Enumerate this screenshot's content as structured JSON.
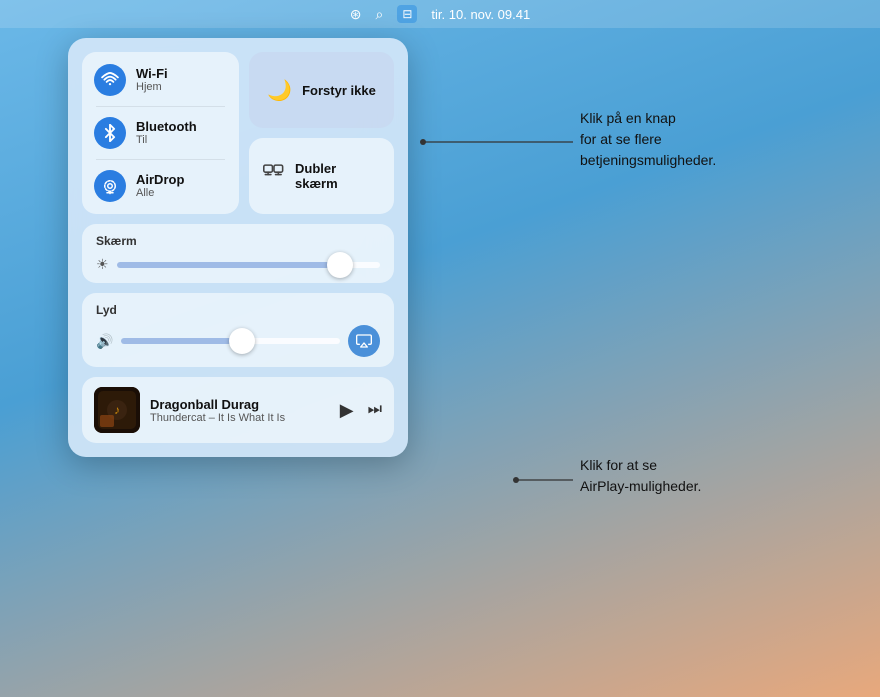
{
  "menubar": {
    "date_time": "tir. 10. nov.  09.41"
  },
  "control_center": {
    "wifi": {
      "title": "Wi-Fi",
      "subtitle": "Hjem"
    },
    "bluetooth": {
      "title": "Bluetooth",
      "subtitle": "Til"
    },
    "airdrop": {
      "title": "AirDrop",
      "subtitle": "Alle"
    },
    "do_not_disturb": {
      "label": "Forstyr ikke"
    },
    "mirror_display": {
      "label": "Dubler skærm"
    },
    "display": {
      "section_label": "Skærm"
    },
    "sound": {
      "section_label": "Lyd"
    },
    "now_playing": {
      "title": "Dragonball Durag",
      "subtitle": "Thundercat – It Is What It Is"
    }
  },
  "annotations": {
    "top": {
      "text": "Klik på en knap\nfor at se flere\nbetjeningsmuligheder."
    },
    "bottom": {
      "text": "Klik for at se\nAirPlay-muligheder."
    }
  }
}
